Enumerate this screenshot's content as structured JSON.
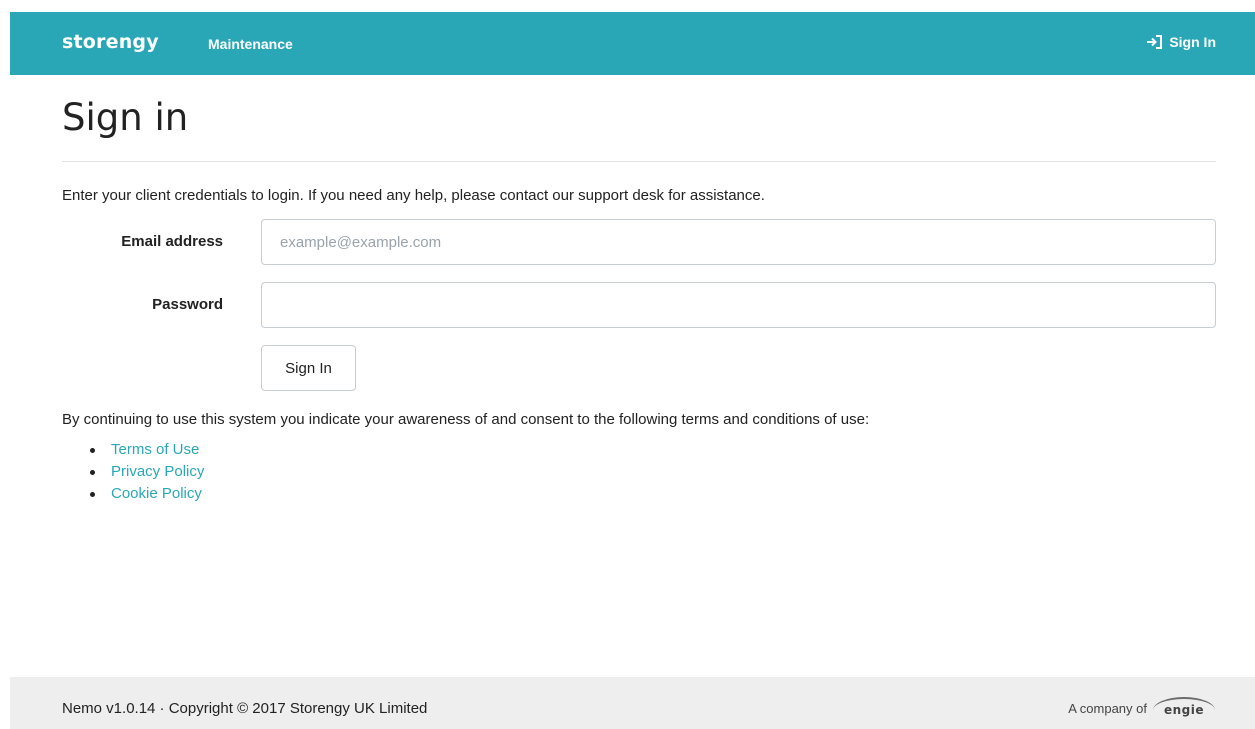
{
  "navbar": {
    "brand": "storengy",
    "maintenance_label": "Maintenance",
    "signin_label": "Sign In",
    "signin_icon": "sign-in-icon",
    "background_color": "#2aa7b7"
  },
  "page": {
    "title": "Sign in",
    "intro": "Enter your client credentials to login. If you need any help, please contact our support desk for assistance."
  },
  "form": {
    "email_label": "Email address",
    "email_placeholder": "example@example.com",
    "email_value": "",
    "password_label": "Password",
    "password_value": "",
    "submit_label": "Sign In"
  },
  "terms": {
    "consent_text": "By continuing to use this system you indicate your awareness of and consent to the following terms and conditions of use:",
    "links": [
      "Terms of Use",
      "Privacy Policy",
      "Cookie Policy"
    ],
    "link_color": "#2aa7b7"
  },
  "footer": {
    "copyright": "Nemo v1.0.14 · Copyright © 2017 Storengy UK Limited",
    "company_prefix": "A company of",
    "company_logo_text": "engie"
  }
}
